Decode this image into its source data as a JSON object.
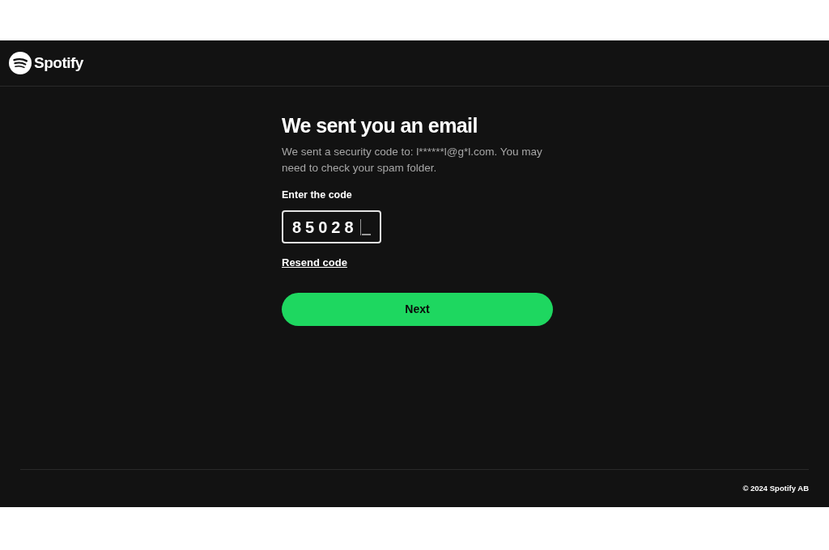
{
  "header": {
    "logo_text": "Spotify"
  },
  "title": "We sent you an email",
  "message": "We sent a security code to: l******l@g*l.com. You may need to check your spam folder.",
  "code_field": {
    "label": "Enter the code",
    "value": "85028",
    "focused": true
  },
  "resend_link": "Resend code",
  "next_button": "Next",
  "footer": {
    "copyright": "© 2024 Spotify AB"
  }
}
